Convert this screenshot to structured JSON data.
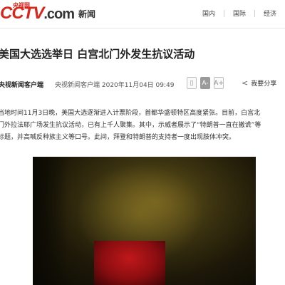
{
  "header": {
    "logo_text": "CCTV",
    "logo_com": ".com",
    "logo_cn": "央视网",
    "logo_sub": "新闻",
    "nav": [
      "国内",
      "国际",
      "经济"
    ]
  },
  "article": {
    "title": "美国大选选举日 白宫北门外发生抗议活动",
    "source": "央视新闻客户端",
    "meta": "央视新闻客户端 2020年11月04日 09:49",
    "tools": {
      "font_small": "A-",
      "font_large": "A+",
      "share_label": "我要分享"
    },
    "paragraphs": [
      "当地时间11月3日晚，美国大选逐渐进入计票阶段，首都华盛顿特区高度紧张。目前，白宫北",
      "门外拉法耶广场发生抗议活动，已有上千人聚集。其中，示威者展示了“特朗普一直在撒谎”等",
      "标题，并高喊反种族主义等口号。此间，拜登和特朗普的支持者一度出现肢体冲突。"
    ]
  },
  "colors": {
    "brand_red": "#d8261d",
    "text": "#222222"
  }
}
